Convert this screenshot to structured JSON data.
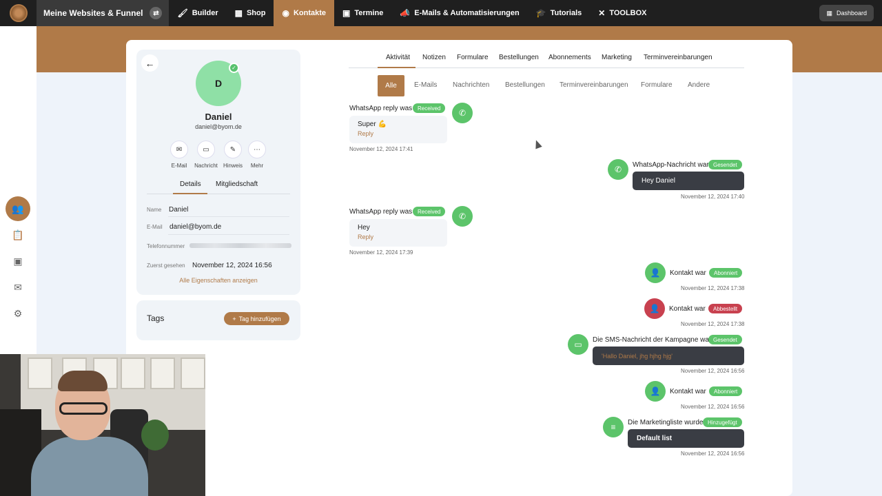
{
  "topnav": {
    "site_switch_label": "Meine Websites & Funnel",
    "items": [
      {
        "label": "Builder",
        "icon": "paintbrush-icon"
      },
      {
        "label": "Shop",
        "icon": "store-icon"
      },
      {
        "label": "Kontakte",
        "icon": "contacts-icon",
        "active": true
      },
      {
        "label": "Termine",
        "icon": "calendar-icon"
      },
      {
        "label": "E-Mails & Automatisierungen",
        "icon": "megaphone-icon"
      },
      {
        "label": "Tutorials",
        "icon": "graduation-cap-icon"
      },
      {
        "label": "TOOLBOX",
        "icon": "tools-icon"
      }
    ],
    "dashboard_label": "Dashboard"
  },
  "profile": {
    "initial": "D",
    "name": "Daniel",
    "email": "daniel@byom.de",
    "actions": [
      "E-Mail",
      "Nachricht",
      "Hinweis",
      "Mehr"
    ],
    "tabs": [
      "Details",
      "Mitgliedschaft"
    ],
    "props": {
      "name_label": "Name",
      "name_value": "Daniel",
      "email_label": "E-Mail",
      "email_value": "daniel@byom.de",
      "phone_label": "Telefonnummer",
      "first_seen_label": "Zuerst gesehen",
      "first_seen_value": "November 12, 2024 16:56"
    },
    "all_props_link": "Alle Eigenschaften anzeigen"
  },
  "tags": {
    "title": "Tags",
    "add_label": "Tag hinzufügen"
  },
  "main_tabs": [
    "Aktivität",
    "Notizen",
    "Formulare",
    "Bestellungen",
    "Abonnements",
    "Marketing",
    "Terminvereinbarungen"
  ],
  "sub_tabs": [
    "Alle",
    "E-Mails",
    "Nachrichten",
    "Bestellungen",
    "Terminvereinbarungen",
    "Formulare",
    "Andere"
  ],
  "timeline": {
    "e1": {
      "text": "WhatsApp reply was",
      "badge": "Received",
      "msg": "Super 💪",
      "reply": "Reply",
      "time": "November 12, 2024 17:41"
    },
    "e2": {
      "text": "WhatsApp-Nachricht war",
      "badge": "Gesendet",
      "msg": "Hey Daniel",
      "time": "November 12, 2024 17:40"
    },
    "e3": {
      "text": "WhatsApp reply was",
      "badge": "Received",
      "msg": "Hey",
      "reply": "Reply",
      "time": "November 12, 2024 17:39"
    },
    "e4": {
      "text": "Kontakt war",
      "badge": "Abonniert",
      "time": "November 12, 2024 17:38"
    },
    "e5": {
      "text": "Kontakt war",
      "badge": "Abbestellt",
      "time": "November 12, 2024 17:38"
    },
    "e6": {
      "text": "Die SMS-Nachricht der Kampagne war",
      "badge": "Gesendet",
      "msg": "'Hallo Daniel, jhg hjhg hjg'",
      "time": "November 12, 2024 16:56"
    },
    "e7": {
      "text": "Kontakt war",
      "badge": "Abonniert",
      "time": "November 12, 2024 16:56"
    },
    "e8": {
      "text": "Die Marketingliste wurde",
      "badge": "Hinzugefügt",
      "msg": "Default list",
      "time": "November 12, 2024 16:56"
    }
  },
  "colors": {
    "accent": "#b07a48",
    "success": "#5cc46a",
    "danger": "#c8414f",
    "dark": "#1f1f1f"
  }
}
